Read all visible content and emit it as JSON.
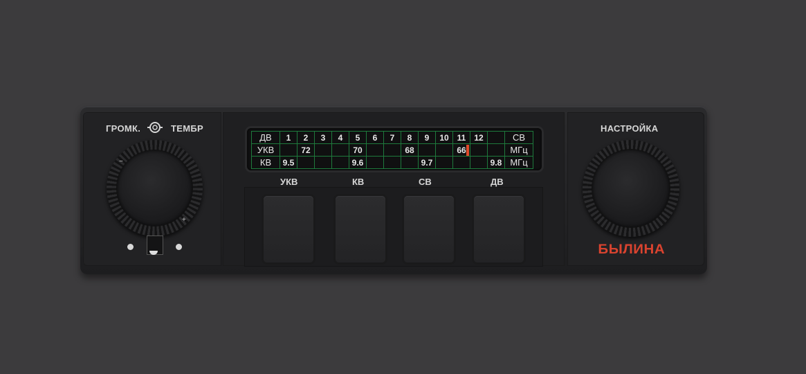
{
  "left": {
    "label_volume": "ГРОМК.",
    "label_tone": "ТЕМБР"
  },
  "right": {
    "label_tuning": "НАСТРОЙКА",
    "brand": "БЫЛИНА"
  },
  "dial": {
    "rows": [
      [
        "ДВ",
        "1",
        "2",
        "3",
        "4",
        "5",
        "6",
        "7",
        "8",
        "9",
        "10",
        "11",
        "12",
        "",
        "СВ"
      ],
      [
        "УКВ",
        "",
        "72",
        "",
        "",
        "70",
        "",
        "",
        "68",
        "",
        "",
        "66",
        "",
        "",
        "МГц"
      ],
      [
        "КВ",
        "9.5",
        "",
        "",
        "",
        "9.6",
        "",
        "",
        "",
        "9.7",
        "",
        "",
        "",
        "9.8",
        "МГц"
      ]
    ],
    "pointer_color": "#e04a2a",
    "grid_color": "#1e7a3c"
  },
  "buttons": [
    {
      "label": "УКВ"
    },
    {
      "label": "КВ"
    },
    {
      "label": "СВ"
    },
    {
      "label": "ДВ"
    }
  ],
  "colors": {
    "background": "#3c3b3d",
    "body": "#232325",
    "brand": "#d9432f"
  }
}
